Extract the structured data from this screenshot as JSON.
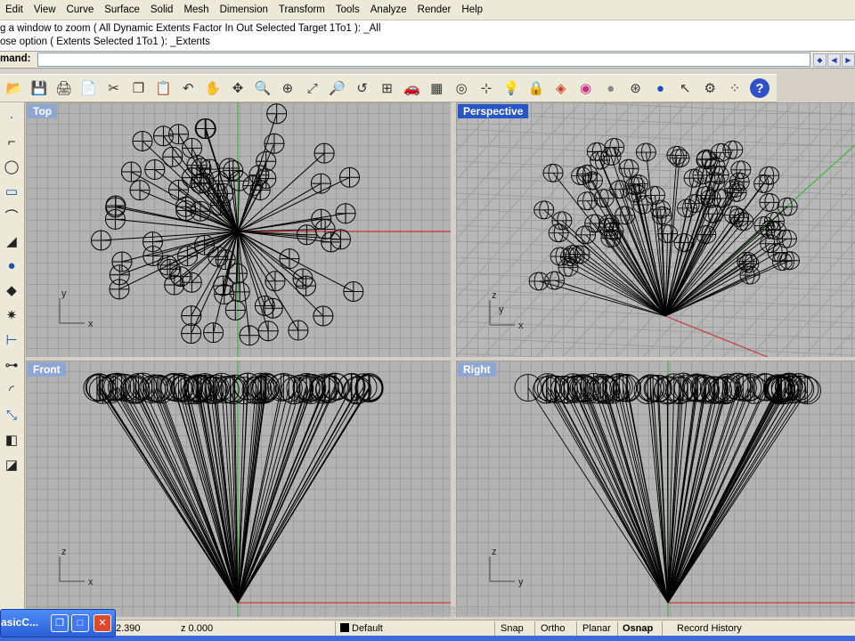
{
  "menu": [
    "Edit",
    "View",
    "Curve",
    "Surface",
    "Solid",
    "Mesh",
    "Dimension",
    "Transform",
    "Tools",
    "Analyze",
    "Render",
    "Help"
  ],
  "history": [
    "g a window to zoom ( All  Dynamic  Extents  Factor  In  Out  Selected  Target  1To1 ): _All",
    "ose option ( Extents  Selected  1To1 ): _Extents"
  ],
  "command": {
    "label": "mand:",
    "value": ""
  },
  "toolbar_icons": [
    "folder-open-icon",
    "save-icon",
    "print-icon",
    "page-setup-icon",
    "cut-icon",
    "copy-icon",
    "paste-icon",
    "undo-icon",
    "pan-icon",
    "rotate-view-icon",
    "zoom-icon",
    "zoom-window-icon",
    "zoom-extents-icon",
    "zoom-selected-icon",
    "undo-view-icon",
    "four-viewports-icon",
    "car-icon",
    "mesh-icon",
    "circle-target-icon",
    "snap-icon",
    "lightbulb-icon",
    "lock-icon",
    "layer-icon",
    "color-wheel-icon",
    "render-sphere-icon",
    "grid-sphere-icon",
    "blue-sphere-icon",
    "pointer-icon",
    "gear-icon",
    "grid-points-icon",
    "help-icon"
  ],
  "left_tools": [
    "point-icon",
    "polyline-icon",
    "circle-icon",
    "rectangle-icon",
    "arc-icon",
    "surface-icon",
    "solid-sphere-icon",
    "mesh-tool-icon",
    "explode-icon",
    "dimension-icon",
    "control-points-icon",
    "fillet-icon",
    "transform-icon",
    "analyze-icon",
    "render-tool-icon"
  ],
  "viewports": {
    "top": {
      "title": "Top",
      "axis_a": "y",
      "axis_b": "x"
    },
    "perspective": {
      "title": "Perspective",
      "axis_a": "z",
      "axis_b": "y",
      "axis_c": "x"
    },
    "front": {
      "title": "Front",
      "axis_a": "z",
      "axis_b": "x"
    },
    "right": {
      "title": "Right",
      "axis_a": "z",
      "axis_b": "y"
    }
  },
  "status": {
    "coord_y": "2.390",
    "coord_z": "z 0.000",
    "layer": "Default",
    "snap": "Snap",
    "ortho": "Ortho",
    "planar": "Planar",
    "osnap": "Osnap",
    "record_history": "Record History"
  },
  "watermark": "Dr. Ricardo Sosa (rdsosam@itesm.mx)",
  "taskbar": {
    "label": "asicC..."
  },
  "colors": {
    "active_title": "#2856c8",
    "inactive_title": "#8ea6d4",
    "x_axis": "#c83c3c",
    "y_axis": "#3cb43c"
  }
}
